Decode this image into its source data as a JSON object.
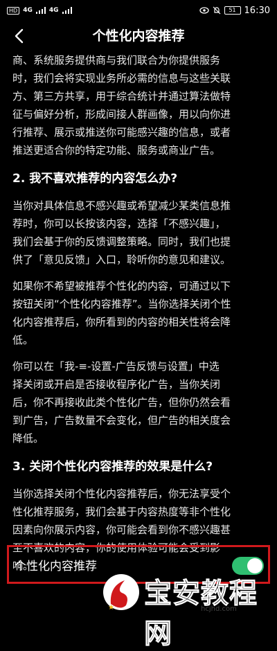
{
  "status_bar": {
    "hd_label": "HD",
    "signal1": "4G",
    "signal2": "4G",
    "battery": "51",
    "time": "16:30"
  },
  "nav": {
    "title": "个性化内容推荐"
  },
  "content": {
    "para1_lines": [
      "商、系统服务提供商与我们联合为你提供服务",
      "时，我们会将实现业务所必需的信息与这些关联",
      "方、第三方共享，用于综合统计并通过算法做特",
      "征与偏好分析，形成间接人群画像，用以向你进",
      "行推荐、展示或推送你可能感兴趣的信息，或者",
      "推送更适合你的特定功能、服务或商业广告。"
    ],
    "heading2": "2. 我不喜欢推荐的内容怎么办?",
    "para2_lines": [
      "当你对具体信息不感兴趣或希望减少某类信息推",
      "荐时，你可以长按该内容，选择「不感兴趣」，",
      "我们会基于你的反馈调整策略。同时，我们也提",
      "供了「意见反馈」入口，聆听你的意见和建议。"
    ],
    "para3_lines": [
      "如果你不希望被推荐个性化的内容，可通过以下",
      "按钮关闭“个性化内容推荐”。当你选择关闭个性",
      "化内容推荐后，你所看到的内容的相关性将会降",
      "低。"
    ],
    "para4_lines": [
      "你可以在「我-≡-设置-广告反馈与设置」中选",
      "择关闭或开启是否接收程序化广告，当你关闭",
      "后，你不再接收此类个性化广告，但你仍然会看",
      "到广告，广告数量不会变化，但广告的相关度会",
      "降低。"
    ],
    "heading3": "3. 关闭个性化内容推荐的效果是什么?",
    "para5_lines": [
      "当你选择关闭个性化内容推荐后，你无法享受个",
      "性化推荐服务，我们会基于内容热度等非个性化",
      "因素向你展示内容，你可能会看到你不感兴趣甚",
      "至不喜欢的内容，你的使用体验可能会受到影",
      "响。"
    ]
  },
  "toggle": {
    "label": "个性化内容推荐",
    "state": "on",
    "accent": "#2fbf71"
  },
  "highlight_color": "#d0191c",
  "watermark": {
    "text": "宝安教程网",
    "url": "hcjhd.com"
  }
}
